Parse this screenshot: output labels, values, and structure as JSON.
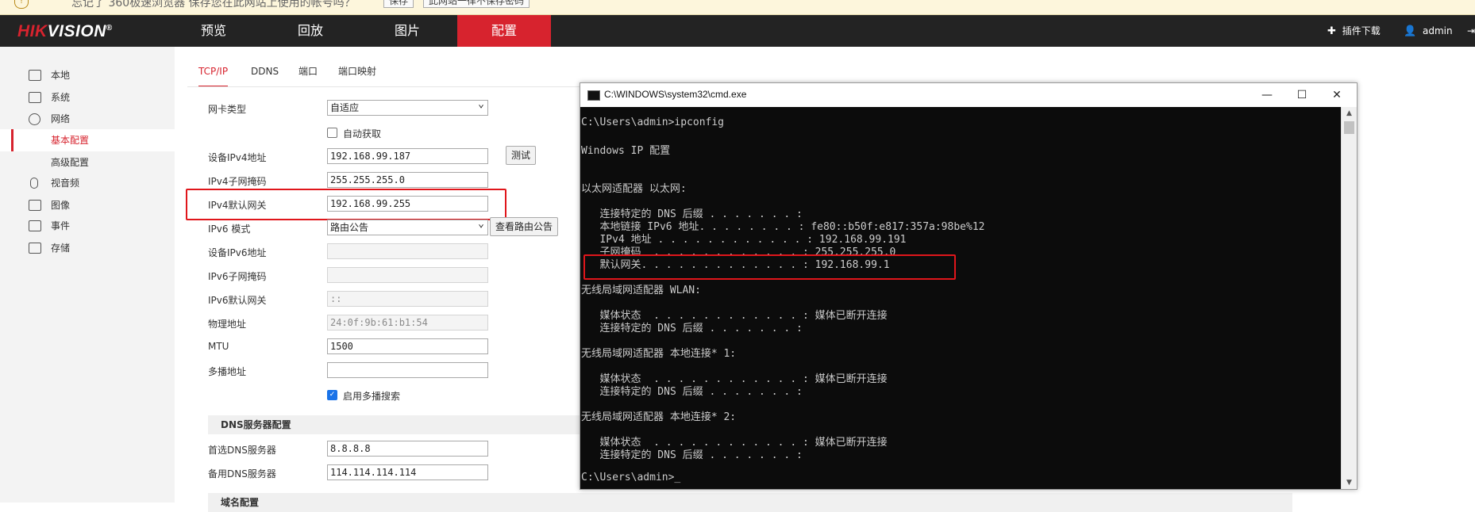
{
  "infobar": {
    "message": "忘记了 360极速浏览器 保存您在此网站上使用的帐号吗？",
    "save": "保存",
    "never": "此网站一律不保存密码"
  },
  "brand": {
    "name": "HIKVISION",
    "reg": "®"
  },
  "nav": {
    "tabs": [
      "预览",
      "回放",
      "图片",
      "配置"
    ],
    "active": "配置",
    "plugin": "插件下载",
    "user": "admin"
  },
  "sidebar": {
    "items": [
      {
        "label": "本地",
        "icon": "monitor-icon"
      },
      {
        "label": "系统",
        "icon": "system-icon"
      },
      {
        "label": "网络",
        "icon": "globe-icon"
      },
      {
        "label": "基本配置",
        "sub": true,
        "active": true
      },
      {
        "label": "高级配置",
        "sub": true
      },
      {
        "label": "视音频",
        "icon": "microphone-icon"
      },
      {
        "label": "图像",
        "icon": "image-icon"
      },
      {
        "label": "事件",
        "icon": "calendar-icon"
      },
      {
        "label": "存储",
        "icon": "disk-icon"
      }
    ]
  },
  "tabs": [
    "TCP/IP",
    "DDNS",
    "端口",
    "端口映射"
  ],
  "form": {
    "nic_type": {
      "label": "网卡类型",
      "value": "自适应"
    },
    "dhcp": {
      "label": "自动获取"
    },
    "ipv4": {
      "label": "设备IPv4地址",
      "value": "192.168.99.187",
      "test": "测试"
    },
    "mask": {
      "label": "IPv4子网掩码",
      "value": "255.255.255.0"
    },
    "gateway": {
      "label": "IPv4默认网关",
      "value": "192.168.99.255"
    },
    "ipv6mode": {
      "label": "IPv6 模式",
      "value": "路由公告",
      "btn": "查看路由公告"
    },
    "ipv6addr": {
      "label": "设备IPv6地址",
      "value": ""
    },
    "ipv6mask": {
      "label": "IPv6子网掩码",
      "value": ""
    },
    "ipv6gw": {
      "label": "IPv6默认网关",
      "value": "::"
    },
    "mac": {
      "label": "物理地址",
      "value": "24:0f:9b:61:b1:54"
    },
    "mtu": {
      "label": "MTU",
      "value": "1500"
    },
    "multicast": {
      "label": "多播地址",
      "value": ""
    },
    "multicast_search": {
      "label": "启用多播搜索"
    },
    "dns_section": "DNS服务器配置",
    "dns1": {
      "label": "首选DNS服务器",
      "value": "8.8.8.8"
    },
    "dns2": {
      "label": "备用DNS服务器",
      "value": "114.114.114.114"
    },
    "next_section": "域名配置"
  },
  "cmd": {
    "title": "C:\\WINDOWS\\system32\\cmd.exe",
    "lines": [
      "C:\\Users\\admin>ipconfig",
      "",
      "Windows IP 配置",
      "",
      "",
      "以太网适配器 以太网:",
      "",
      "   连接特定的 DNS 后缀 . . . . . . . :",
      "   本地链接 IPv6 地址. . . . . . . . : fe80::b50f:e817:357a:98be%12",
      "   IPv4 地址 . . . . . . . . . . . . : 192.168.99.191",
      "   子网掩码  . . . . . . . . . . . . : 255.255.255.0",
      "   默认网关. . . . . . . . . . . . . : 192.168.99.1",
      "",
      "无线局域网适配器 WLAN:",
      "",
      "   媒体状态  . . . . . . . . . . . . : 媒体已断开连接",
      "   连接特定的 DNS 后缀 . . . . . . . :",
      "",
      "无线局域网适配器 本地连接* 1:",
      "",
      "   媒体状态  . . . . . . . . . . . . : 媒体已断开连接",
      "   连接特定的 DNS 后缀 . . . . . . . :",
      "",
      "无线局域网适配器 本地连接* 2:",
      "",
      "   媒体状态  . . . . . . . . . . . . : 媒体已断开连接",
      "   连接特定的 DNS 后缀 . . . . . . . :",
      "",
      "C:\\Users\\admin>_"
    ]
  }
}
